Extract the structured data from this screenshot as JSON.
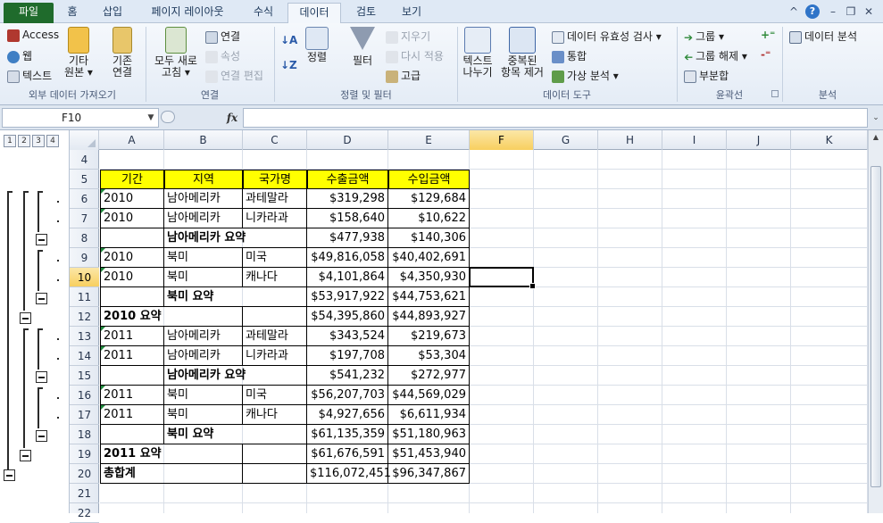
{
  "tabs": [
    "파일",
    "홈",
    "삽입",
    "페이지 레이아웃",
    "수식",
    "데이터",
    "검토",
    "보기"
  ],
  "active_tab": "데이터",
  "help_glyph": "?",
  "ribbon": {
    "ext": {
      "access": "Access",
      "web": "웹",
      "text": "텍스트",
      "other_l1": "기타",
      "other_l2": "원본 ▾",
      "existing_l1": "기존",
      "existing_l2": "연결",
      "label": "외부 데이터 가져오기"
    },
    "conn": {
      "refresh_l1": "모두 새로",
      "refresh_l2": "고침 ▾",
      "connections": "연결",
      "properties": "속성",
      "edit_links": "연결 편집",
      "label": "연결"
    },
    "sort": {
      "sort": "정렬",
      "filter": "필터",
      "clear": "지우기",
      "reapply": "다시 적용",
      "advanced": "고급",
      "label": "정렬 및 필터"
    },
    "tools": {
      "t2c_l1": "텍스트",
      "t2c_l2": "나누기",
      "dup_l1": "중복된",
      "dup_l2": "항목 제거",
      "validation": "데이터 유효성 검사 ▾",
      "consolidate": "통합",
      "whatif": "가상 분석 ▾",
      "label": "데이터 도구"
    },
    "outline": {
      "group": "그룹 ▾",
      "ungroup": "그룹 해제 ▾",
      "subtotal": "부분합",
      "label": "윤곽선"
    },
    "analysis": {
      "data_analysis": "데이터 분석",
      "label": "분석"
    }
  },
  "formula_bar": {
    "name_box": "F10",
    "fx": "fx",
    "formula": ""
  },
  "outline_levels": [
    "1",
    "2",
    "3",
    "4"
  ],
  "columns": [
    "A",
    "B",
    "C",
    "D",
    "E",
    "F",
    "G",
    "H",
    "I",
    "J",
    "K"
  ],
  "selected_column": "F",
  "selected_row": "10",
  "rows": [
    {
      "n": "4",
      "cells": [
        "",
        "",
        "",
        "",
        ""
      ]
    },
    {
      "n": "5",
      "cells": [
        "기간",
        "지역",
        "국가명",
        "수출금액",
        "수입금액"
      ],
      "header": true
    },
    {
      "n": "6",
      "cells": [
        "2010",
        "남아메리카",
        "과테말라",
        "$319,298",
        "$129,684"
      ]
    },
    {
      "n": "7",
      "cells": [
        "2010",
        "남아메리카",
        "니카라과",
        "$158,640",
        "$10,622"
      ]
    },
    {
      "n": "8",
      "cells": [
        "",
        "남아메리카 요약",
        "",
        "$477,938",
        "$140,306"
      ],
      "subtotal": true
    },
    {
      "n": "9",
      "cells": [
        "2010",
        "북미",
        "미국",
        "$49,816,058",
        "$40,402,691"
      ]
    },
    {
      "n": "10",
      "cells": [
        "2010",
        "북미",
        "캐나다",
        "$4,101,864",
        "$4,350,930"
      ]
    },
    {
      "n": "11",
      "cells": [
        "",
        "북미 요약",
        "",
        "$53,917,922",
        "$44,753,621"
      ],
      "subtotal": true
    },
    {
      "n": "12",
      "cells": [
        "2010 요약",
        "",
        "",
        "$54,395,860",
        "$44,893,927"
      ],
      "summary": true
    },
    {
      "n": "13",
      "cells": [
        "2011",
        "남아메리카",
        "과테말라",
        "$343,524",
        "$219,673"
      ]
    },
    {
      "n": "14",
      "cells": [
        "2011",
        "남아메리카",
        "니카라과",
        "$197,708",
        "$53,304"
      ]
    },
    {
      "n": "15",
      "cells": [
        "",
        "남아메리카 요약",
        "",
        "$541,232",
        "$272,977"
      ],
      "subtotal": true
    },
    {
      "n": "16",
      "cells": [
        "2011",
        "북미",
        "미국",
        "$56,207,703",
        "$44,569,029"
      ]
    },
    {
      "n": "17",
      "cells": [
        "2011",
        "북미",
        "캐나다",
        "$4,927,656",
        "$6,611,934"
      ]
    },
    {
      "n": "18",
      "cells": [
        "",
        "북미 요약",
        "",
        "$61,135,359",
        "$51,180,963"
      ],
      "subtotal": true
    },
    {
      "n": "19",
      "cells": [
        "2011 요약",
        "",
        "",
        "$61,676,591",
        "$51,453,940"
      ],
      "summary": true
    },
    {
      "n": "20",
      "cells": [
        "총합계",
        "",
        "",
        "$116,072,451",
        "$96,347,867"
      ],
      "summary": true
    },
    {
      "n": "21",
      "cells": [
        "",
        "",
        "",
        "",
        ""
      ]
    },
    {
      "n": "22",
      "cells": [
        "",
        "",
        "",
        "",
        ""
      ]
    }
  ],
  "colors": {
    "header_fill": "#ffff00",
    "file_tab": "#1f6b2c",
    "selection": "#f8cf5f"
  }
}
